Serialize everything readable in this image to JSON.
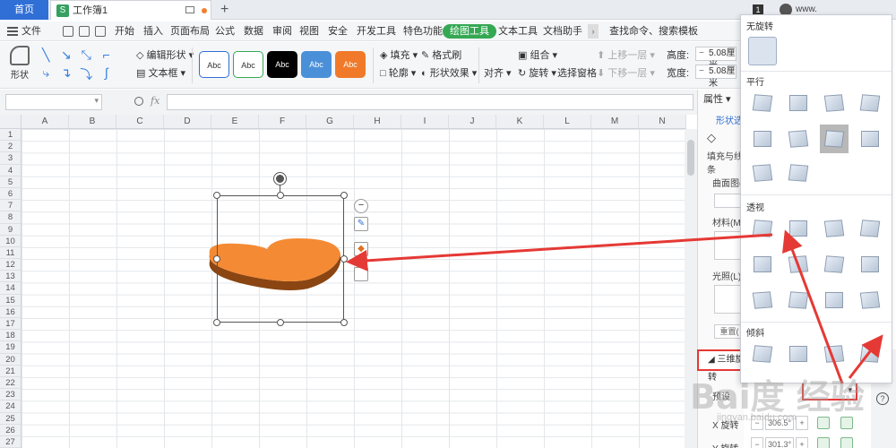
{
  "titlebar": {
    "home_tab": "首页",
    "doc_title": "工作簿1",
    "badge": "1",
    "user": "www."
  },
  "menubar": {
    "file": "文件",
    "items": [
      "开始",
      "插入",
      "页面布局",
      "公式",
      "数据",
      "审阅",
      "视图",
      "安全",
      "开发工具",
      "特色功能",
      "绘图工具",
      "文本工具",
      "文档助手"
    ],
    "active": "绘图工具",
    "search": "查找命令、搜索模板",
    "more": "未保"
  },
  "toolbar": {
    "shapes": "形状",
    "edit_shape": "编辑形状",
    "text_box": "文本框",
    "style_samples": [
      "Abc",
      "Abc",
      "Abc",
      "Abc",
      "Abc"
    ],
    "fill": "填充",
    "format_painter": "格式刷",
    "outline": "轮廓",
    "shape_effect": "形状效果",
    "align": "对齐",
    "group": "组合",
    "rotate": "旋转",
    "select_pane": "选择窗格",
    "bring_forward": "上移一层",
    "send_backward": "下移一层",
    "height_label": "高度:",
    "height_value": "5.08厘米",
    "width_label": "宽度:",
    "width_value": "5.08厘米"
  },
  "formulabar": {
    "fx": "fx"
  },
  "grid": {
    "columns": [
      "A",
      "B",
      "C",
      "D",
      "E",
      "F",
      "G",
      "H",
      "I",
      "J",
      "K",
      "L",
      "M",
      "N"
    ],
    "rows": [
      "1",
      "2",
      "3",
      "4",
      "5",
      "6",
      "7",
      "8",
      "9",
      "10",
      "11",
      "12",
      "13",
      "14",
      "15",
      "16",
      "17",
      "18",
      "19",
      "20",
      "21",
      "22",
      "23",
      "24",
      "25",
      "26",
      "27"
    ]
  },
  "properties": {
    "title": "属性",
    "shape_options": "形状选",
    "fill_line": "填充与线条",
    "curved_surface": "曲面图(",
    "material": "材料(M",
    "lighting": "光照(L)",
    "reset": "重置(",
    "three_d_rotation": "三维旋转",
    "preset": "预设",
    "x_rotation_label": "X 旋转",
    "x_rotation_value": "306.5°",
    "y_rotation_label": "Y 旋转",
    "y_rotation_value": "301.3°"
  },
  "gallery": {
    "no_rotation": "无旋转",
    "parallel": "平行",
    "perspective": "透视",
    "oblique": "倾斜"
  },
  "colors": {
    "heart_fill": "#f58a34",
    "heart_side": "#8a4512",
    "accent_green": "#34a853",
    "arrow_red": "#e53935",
    "home_tab": "#2f6fd6"
  },
  "watermark": {
    "brand": "Bai度 经验",
    "url": "jingyan.baidu.com"
  }
}
